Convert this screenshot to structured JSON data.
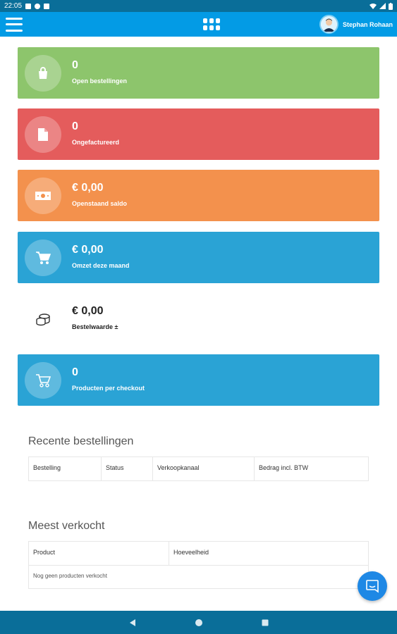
{
  "statusbar": {
    "time": "22:05"
  },
  "appbar": {
    "user_name": "Stephan Rohaan"
  },
  "cards": [
    {
      "value": "0",
      "label": "Open bestellingen",
      "icon": "bag-icon",
      "color": "#8dc56c"
    },
    {
      "value": "0",
      "label": "Ongefactureerd",
      "icon": "document-icon",
      "color": "#e45c5c"
    },
    {
      "value": "€ 0,00",
      "label": "Openstaand saldo",
      "icon": "money-icon",
      "color": "#f3914d"
    },
    {
      "value": "€ 0,00",
      "label": "Omzet deze maand",
      "icon": "cart-icon",
      "color": "#2aa3d5"
    },
    {
      "value": "€ 0,00",
      "label": "Bestelwaarde ±",
      "icon": "coins-icon",
      "color": "#ffffff"
    },
    {
      "value": "0",
      "label": "Producten per checkout",
      "icon": "cart-outline-icon",
      "color": "#2aa3d5"
    }
  ],
  "recent_orders": {
    "title": "Recente bestellingen",
    "columns": [
      "Bestelling",
      "Status",
      "Verkoopkanaal",
      "Bedrag incl. BTW"
    ]
  },
  "best_sold": {
    "title": "Meest verkocht",
    "columns": [
      "Product",
      "Hoeveelheid"
    ],
    "empty_text": "Nog geen producten verkocht"
  }
}
